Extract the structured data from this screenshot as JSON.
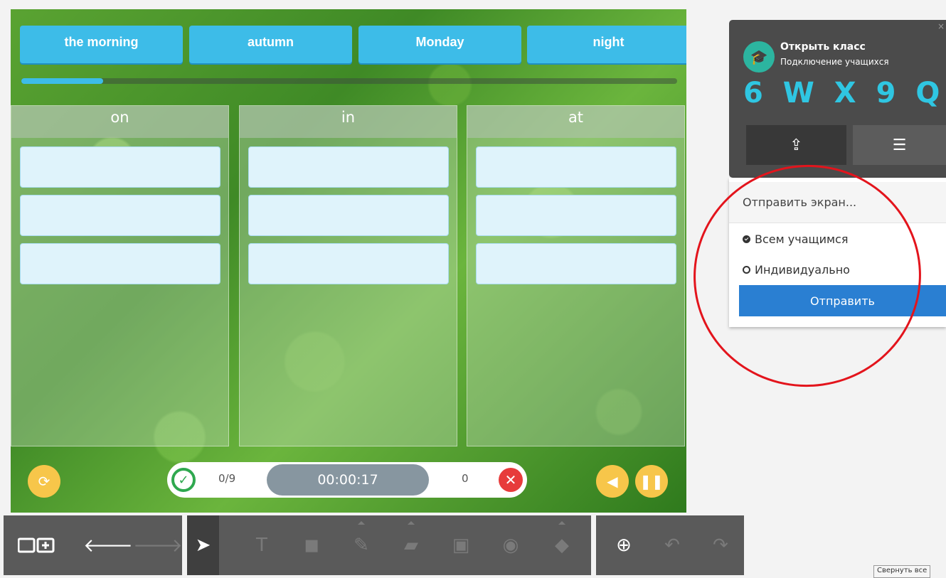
{
  "game": {
    "cards": [
      "the morning",
      "autumn",
      "Monday",
      "night"
    ],
    "progress_fraction": 0.125,
    "columns": [
      {
        "header": "on",
        "slots": 3
      },
      {
        "header": "in",
        "slots": 3
      },
      {
        "header": "at",
        "slots": 3
      }
    ],
    "correct_count": "0/9",
    "timer": "00:00:17",
    "wrong_count": "0",
    "icons": {
      "restart": "refresh-icon",
      "correct": "check-icon",
      "wrong": "cross-icon",
      "sound": "speaker-icon",
      "pause": "pause-icon"
    }
  },
  "toolbar": {
    "groups": [
      [
        "screens-icon",
        "arrow-left-icon",
        "arrow-right-icon"
      ],
      [
        "pointer-icon",
        "text-icon",
        "shapes-icon",
        "pen-icon",
        "eraser-icon",
        "stamp-icon",
        "palette-icon",
        "fill-icon"
      ],
      [
        "zoom-icon",
        "undo-icon",
        "redo-icon"
      ]
    ],
    "collapse_label": "Свернуть все"
  },
  "class_panel": {
    "title": "Открыть класс",
    "subtitle": "Подключение учащихся",
    "code": "6 W X 9 Q",
    "tabs": [
      "share-icon",
      "list-icon"
    ]
  },
  "send_panel": {
    "title": "Отправить экран...",
    "options": [
      {
        "label": "Всем учащимся",
        "selected": true
      },
      {
        "label": "Индивидуально",
        "selected": false
      }
    ],
    "send_label": "Отправить"
  },
  "colors": {
    "card": "#3dbce8",
    "code": "#2fc6e2",
    "send_button": "#2a7fd2",
    "annotation": "#e3141c"
  }
}
